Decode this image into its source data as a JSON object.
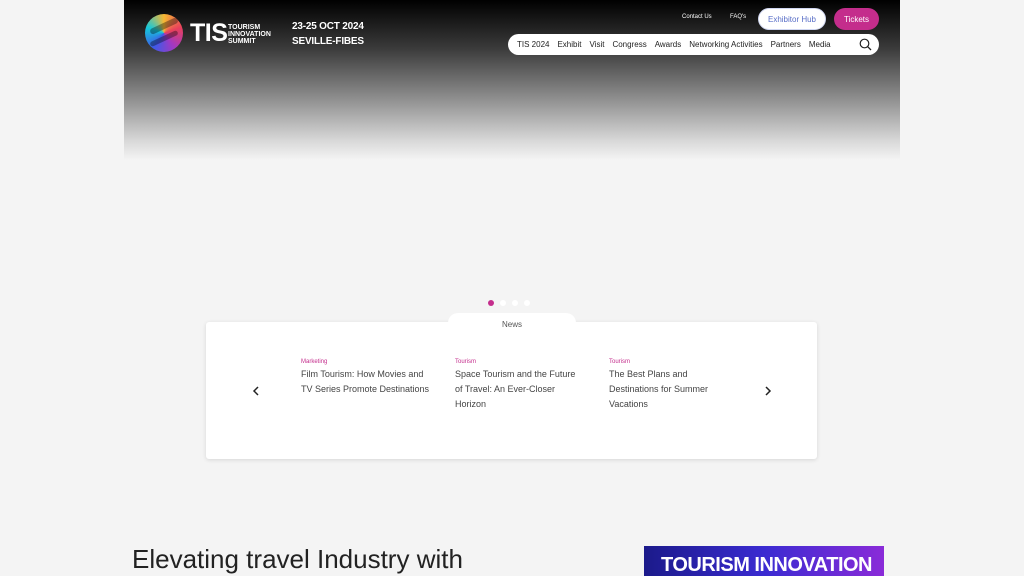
{
  "logo": {
    "abbr": "TIS",
    "line1": "TOURISM",
    "line2": "INNOVATION",
    "line3": "SUMMIT"
  },
  "event": {
    "dates": "23-25 OCT 2024",
    "location": "SEVILLE-FIBES"
  },
  "utility_nav": {
    "contact": "Contact Us",
    "faqs": "FAQ's",
    "exhibitor_hub": "Exhibitor Hub",
    "tickets": "Tickets"
  },
  "main_nav": [
    "TIS 2024",
    "Exhibit",
    "Visit",
    "Congress",
    "Awards",
    "Networking Activities",
    "Partners",
    "Media"
  ],
  "colors": {
    "brand_pink": "#c42d8c",
    "exhibitor_blue": "#5a6fc7"
  },
  "carousel": {
    "slide_count": 4,
    "active_index": 0
  },
  "news": {
    "tab_label": "News",
    "items": [
      {
        "category": "Marketing",
        "title": "Film Tourism: How Movies and TV Series Promote Destinations"
      },
      {
        "category": "Tourism",
        "title": "Space Tourism and the Future of Travel: An Ever-Closer Horizon"
      },
      {
        "category": "Tourism",
        "title": "The Best Plans and Destinations for Summer Vacations"
      }
    ]
  },
  "headline": "Elevating travel Industry with",
  "promo_banner": {
    "text": "TOURISM INNOVATION"
  },
  "icons": {
    "search": "search-icon",
    "prev": "chevron-left-icon",
    "next": "chevron-right-icon"
  }
}
